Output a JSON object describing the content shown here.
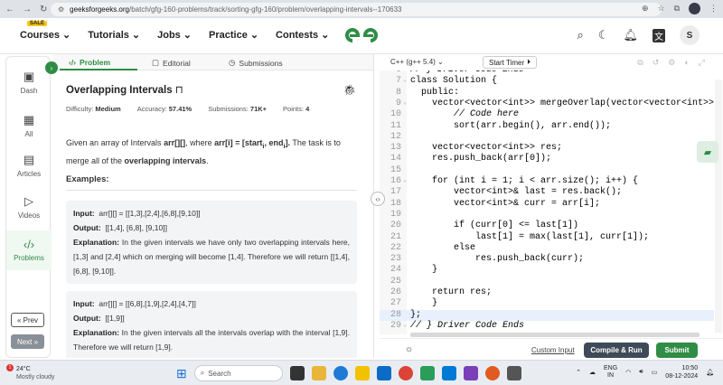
{
  "browser": {
    "url_domain": "geeksforgeeks.org",
    "url_path": "/batch/gfg-160-problems/track/sorting-gfg-160/problem/overlapping-intervals--170633"
  },
  "topnav": {
    "sale_badge": "SALE",
    "menu": [
      "Courses",
      "Tutorials",
      "Jobs",
      "Practice",
      "Contests"
    ],
    "user_initial": "S"
  },
  "rail": {
    "items": [
      {
        "label": "Dash",
        "icon": "dashboard-icon"
      },
      {
        "label": "All",
        "icon": "grid-icon"
      },
      {
        "label": "Articles",
        "icon": "articles-icon"
      },
      {
        "label": "Videos",
        "icon": "video-icon"
      },
      {
        "label": "Problems",
        "icon": "code-icon"
      }
    ],
    "prev_label": "Prev",
    "next_label": "Next"
  },
  "tabs": [
    "Problem",
    "Editorial",
    "Submissions"
  ],
  "problem": {
    "title": "Overlapping Intervals",
    "difficulty_label": "Difficulty:",
    "difficulty": "Medium",
    "accuracy_label": "Accuracy:",
    "accuracy": "57.41%",
    "submissions_label": "Submissions:",
    "submissions": "71K+",
    "points_label": "Points:",
    "points": "4",
    "desc_1": "Given an array of Intervals ",
    "desc_arr": "arr[][]",
    "desc_2": ", where ",
    "desc_def": "arr[i] = [start",
    "desc_i1": "i",
    "desc_mid": ", end",
    "desc_i2": "i",
    "desc_close": "].",
    "desc_3": " The task is to merge all of the ",
    "desc_bold": "overlapping intervals",
    "desc_end": ".",
    "examples_heading": "Examples:",
    "examples": [
      {
        "input_label": "Input:",
        "input": "arr[][]  =  [[1,3],[2,4],[6,8],[9,10]]",
        "output_label": "Output:",
        "output": "[[1,4],  [6,8],  [9,10]]",
        "explanation_label": "Explanation:",
        "explanation": "In the given intervals we have only two overlapping intervals here, [1,3] and [2,4] which on merging will become [1,4]. Therefore we will return [[1,4], [6,8], [9,10]]."
      },
      {
        "input_label": "Input:",
        "input": "arr[][]  =  [[6,8],[1,9],[2,4],[4,7]]",
        "output_label": "Output:",
        "output": "[[1,9]]",
        "explanation_label": "Explanation:",
        "explanation": "In the given intervals all the intervals overlap with the interval [1,9]. Therefore we will return [1,9]."
      }
    ]
  },
  "editor": {
    "language": "C++ (g++ 5.4)",
    "timer_label": "Start Timer",
    "lines": [
      {
        "n": "6",
        "code": "// } Driver Code Ends",
        "style": "cm"
      },
      {
        "n": "7",
        "code": "class Solution {",
        "fold": true
      },
      {
        "n": "8",
        "code": "  public:"
      },
      {
        "n": "9",
        "code": "    vector<vector<int>> mergeOverlap(vector<vector<int>>& a",
        "fold": true
      },
      {
        "n": "10",
        "code": "        // Code here",
        "style": "cm"
      },
      {
        "n": "11",
        "code": "        sort(arr.begin(), arr.end());"
      },
      {
        "n": "12",
        "code": ""
      },
      {
        "n": "13",
        "code": "    vector<vector<int>> res;"
      },
      {
        "n": "14",
        "code": "    res.push_back(arr[0]);"
      },
      {
        "n": "15",
        "code": ""
      },
      {
        "n": "16",
        "code": "    for (int i = 1; i < arr.size(); i++) {",
        "fold": true
      },
      {
        "n": "17",
        "code": "        vector<int>& last = res.back();"
      },
      {
        "n": "18",
        "code": "        vector<int>& curr = arr[i];"
      },
      {
        "n": "19",
        "code": ""
      },
      {
        "n": "20",
        "code": "        if (curr[0] <= last[1])"
      },
      {
        "n": "21",
        "code": "            last[1] = max(last[1], curr[1]);"
      },
      {
        "n": "22",
        "code": "        else"
      },
      {
        "n": "23",
        "code": "            res.push_back(curr);"
      },
      {
        "n": "24",
        "code": "    }"
      },
      {
        "n": "25",
        "code": ""
      },
      {
        "n": "26",
        "code": "    return res;"
      },
      {
        "n": "27",
        "code": "    }"
      },
      {
        "n": "28",
        "code": "};",
        "hl": true
      },
      {
        "n": "29",
        "code": "// } Driver Code Ends",
        "style": "cm",
        "fold": true
      }
    ],
    "custom_input": "Custom Input",
    "compile_run": "Compile & Run",
    "submit": "Submit"
  },
  "taskbar": {
    "temp": "24°C",
    "weather": "Mostly cloudy",
    "badge": "1",
    "search": "Search",
    "lang_top": "ENG",
    "lang_bottom": "IN",
    "time": "10:50",
    "date": "08-12-2024"
  },
  "colors": {
    "brand": "#2f8d46",
    "dark_button": "#3e4a57"
  }
}
